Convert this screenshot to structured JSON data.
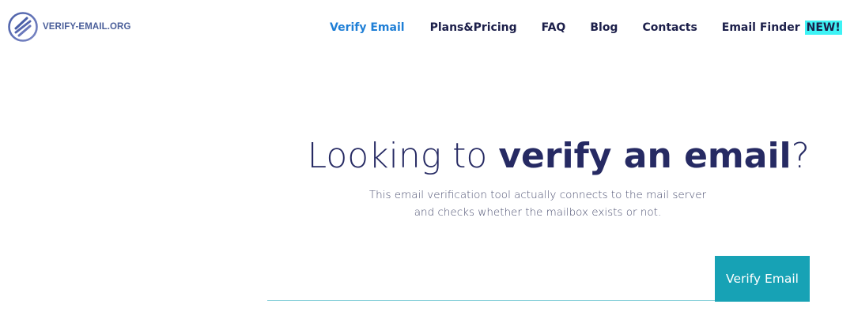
{
  "brand": {
    "name": "VERIFY-EMAIL.ORG",
    "accent_color": "#4b5f9a"
  },
  "nav": {
    "items": [
      {
        "label": "Verify Email",
        "active": true
      },
      {
        "label": "Plans&Pricing",
        "active": false
      },
      {
        "label": "FAQ",
        "active": false
      },
      {
        "label": "Blog",
        "active": false
      },
      {
        "label": "Contacts",
        "active": false
      },
      {
        "label": "Email Finder",
        "active": false,
        "badge": "NEW!"
      }
    ],
    "active_color": "#1f7fd6",
    "text_color": "#1c1f4a",
    "badge_color": "#3df3f5"
  },
  "hero": {
    "title_prefix": "Looking to ",
    "title_emphasis": "verify an email",
    "title_suffix": "?",
    "subtitle_line1": "This email verification tool actually connects to the mail server",
    "subtitle_line2": "and checks whether the mailbox exists or not.",
    "title_color": "#262a63"
  },
  "form": {
    "email_value": "",
    "email_placeholder": "",
    "button_label": "Verify Email",
    "button_color": "#17a2b5"
  }
}
